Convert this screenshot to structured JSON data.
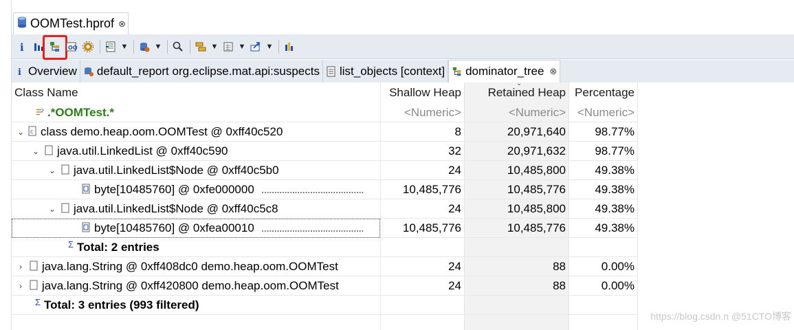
{
  "editor": {
    "tab_title": "OOMTest.hprof",
    "tab_close": "⊗"
  },
  "toolbar": {
    "items": [
      "info-icon",
      "histogram-icon",
      "dominator-tree-icon",
      "oql-icon",
      "settings-gear-icon",
      "thread-overview-icon",
      "dropdown",
      "run-report-icon",
      "dropdown",
      "search-icon",
      "group-icon",
      "dropdown",
      "calculator-icon",
      "dropdown",
      "export-icon",
      "dropdown",
      "heap-dump-overview-icon"
    ]
  },
  "subtabs": [
    {
      "label": "Overview",
      "icon": "info-icon"
    },
    {
      "label": "default_report  org.eclipse.mat.api:suspects",
      "icon": "report-icon"
    },
    {
      "label": "list_objects [context]",
      "icon": "list-icon"
    },
    {
      "label": "dominator_tree",
      "icon": "dominator-tree-icon",
      "active": true,
      "close": "⊗"
    }
  ],
  "table": {
    "headers": {
      "name": "Class Name",
      "shallow": "Shallow Heap",
      "retained": "Retained Heap",
      "percentage": "Percentage"
    },
    "filter_row": {
      "name": ".*OOMTest.*",
      "shallow": "<Numeric>",
      "retained": "<Numeric>",
      "percentage": "<Numeric>"
    },
    "rows": [
      {
        "name": "class demo.heap.oom.OOMTest @ 0xff40c520",
        "shallow": "8",
        "retained": "20,971,640",
        "percentage": "98.77%"
      },
      {
        "name": "java.util.LinkedList @ 0xff40c590",
        "shallow": "32",
        "retained": "20,971,632",
        "percentage": "98.77%"
      },
      {
        "name": "java.util.LinkedList$Node @ 0xff40c5b0",
        "shallow": "24",
        "retained": "10,485,800",
        "percentage": "49.38%"
      },
      {
        "name": "byte[10485760] @ 0xfe000000",
        "shallow": "10,485,776",
        "retained": "10,485,776",
        "percentage": "49.38%",
        "dots": "........................................"
      },
      {
        "name": "java.util.LinkedList$Node @ 0xff40c5c8",
        "shallow": "24",
        "retained": "10,485,800",
        "percentage": "49.38%"
      },
      {
        "name": "byte[10485760] @ 0xfea00010",
        "shallow": "10,485,776",
        "retained": "10,485,776",
        "percentage": "49.38%",
        "dots": "........................................"
      },
      {
        "name": "Total: 2 entries"
      },
      {
        "name": "java.lang.String @ 0xff408dc0  demo.heap.oom.OOMTest",
        "shallow": "24",
        "retained": "88",
        "percentage": "0.00%"
      },
      {
        "name": "java.lang.String @ 0xff420800  demo.heap.oom.OOMTest",
        "shallow": "24",
        "retained": "88",
        "percentage": "0.00%"
      },
      {
        "name": "Total: 3 entries (993 filtered)"
      }
    ],
    "sigma": "Σ"
  },
  "watermark": "https://blog.csdn.n  @51CTO博客"
}
